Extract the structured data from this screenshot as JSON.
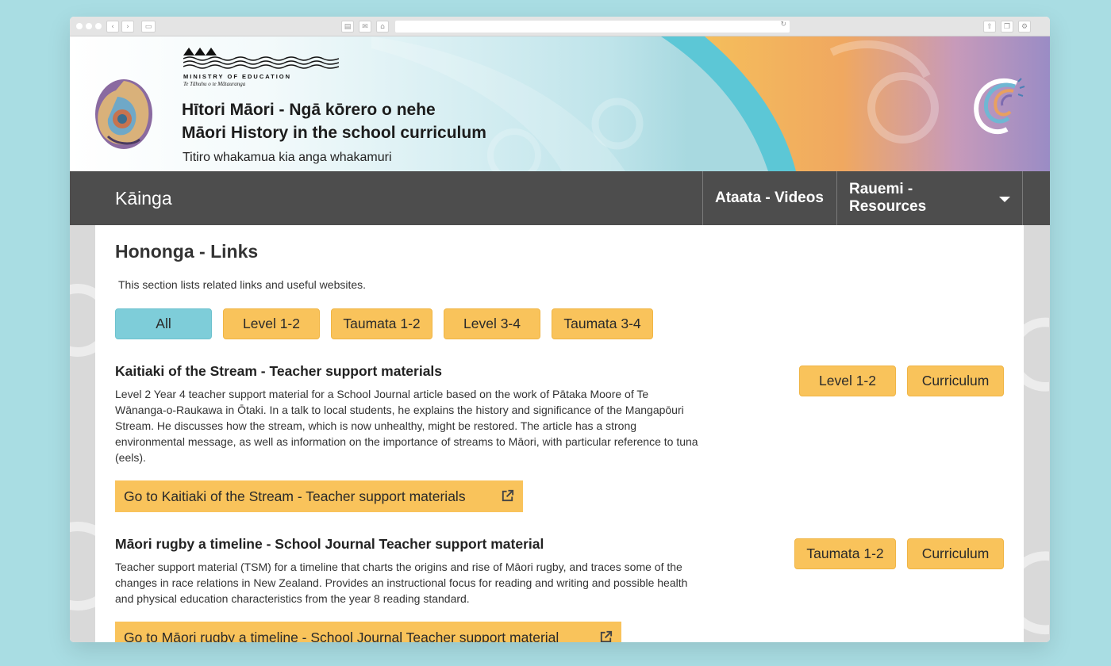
{
  "banner": {
    "ministry": "MINISTRY OF EDUCATION",
    "ministry_maori": "Te Tāhuhu o te Mātauranga",
    "title_maori": "Hītori Māori - Ngā kōrero o nehe",
    "title_english": "Māori History in the school curriculum",
    "tagline": "Titiro whakamua kia anga whakamuri"
  },
  "nav": {
    "home": "Kāinga",
    "videos": "Ataata - Videos",
    "resources": "Rauemi - Resources"
  },
  "page": {
    "title": "Hononga - Links",
    "intro": "This section lists related links and useful websites."
  },
  "filters": [
    {
      "label": "All",
      "active": true
    },
    {
      "label": "Level 1-2",
      "active": false
    },
    {
      "label": "Taumata 1-2",
      "active": false
    },
    {
      "label": "Level 3-4",
      "active": false
    },
    {
      "label": "Taumata 3-4",
      "active": false
    }
  ],
  "items": [
    {
      "title": "Kaitiaki of the Stream - Teacher support materials",
      "description": "Level 2 Year 4 teacher support material for a School Journal article based on the work of Pātaka Moore of Te Wānanga-o-Raukawa in Ōtaki. In a talk to local students, he explains the history and significance of the Mangapōuri Stream. He discusses how the stream, which is now unhealthy, might be restored. The article has a strong environmental message, as well as information on the importance of streams to Māori, with particular reference to tuna (eels).",
      "tags": [
        "Level 1-2",
        "Curriculum"
      ],
      "link": "Go to Kaitiaki of the Stream - Teacher support materials"
    },
    {
      "title": "Māori rugby a timeline - School Journal Teacher support material",
      "description": "Teacher support material (TSM) for a timeline that charts the origins and rise of Māori rugby, and traces some of the changes in race relations in New Zealand. Provides an instructional focus for reading and writing and possible health and physical education characteristics from the year 8 reading standard.",
      "tags": [
        "Taumata 1-2",
        "Curriculum"
      ],
      "link": "Go to Māori rugby a timeline - School Journal Teacher support material"
    }
  ],
  "colors": {
    "accent_yellow": "#f9c35b",
    "accent_teal": "#7ecdd9",
    "navbar": "#4d4d4d",
    "background": "#a9dde3"
  },
  "icons": [
    "external-link-icon",
    "caret-down-icon",
    "ammonite-shell-icon",
    "koru-logo-icon"
  ]
}
